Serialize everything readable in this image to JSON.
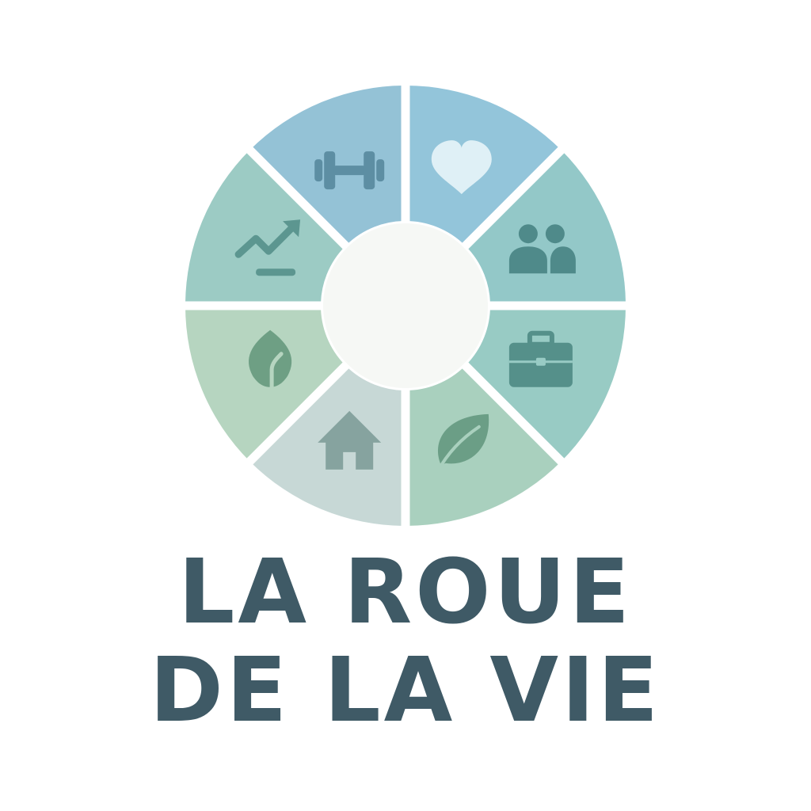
{
  "logo": {
    "title_lines": [
      "LA ROUE",
      "DE LA VIE"
    ],
    "colors": {
      "title": "#3f5a66",
      "center": "#f6f8f5",
      "gap": "#ffffff"
    },
    "segments": [
      {
        "icon": "heart-icon",
        "fill": "#93c5da",
        "icon_color": "#dff0f6"
      },
      {
        "icon": "people-icon",
        "fill": "#93c8c8",
        "icon_color": "#4f8a8a"
      },
      {
        "icon": "briefcase-icon",
        "fill": "#98cbc4",
        "icon_color": "#55908a"
      },
      {
        "icon": "leaf-icon",
        "fill": "#a9d0be",
        "icon_color": "#6b9e86"
      },
      {
        "icon": "home-icon",
        "fill": "#c7d8d6",
        "icon_color": "#86a39f"
      },
      {
        "icon": "sprout-icon",
        "fill": "#b6d5c0",
        "icon_color": "#6e9f84"
      },
      {
        "icon": "growth-icon",
        "fill": "#9ccbc4",
        "icon_color": "#5c9690"
      },
      {
        "icon": "dumbbell-icon",
        "fill": "#94c2d6",
        "icon_color": "#5d8ea3"
      }
    ]
  }
}
